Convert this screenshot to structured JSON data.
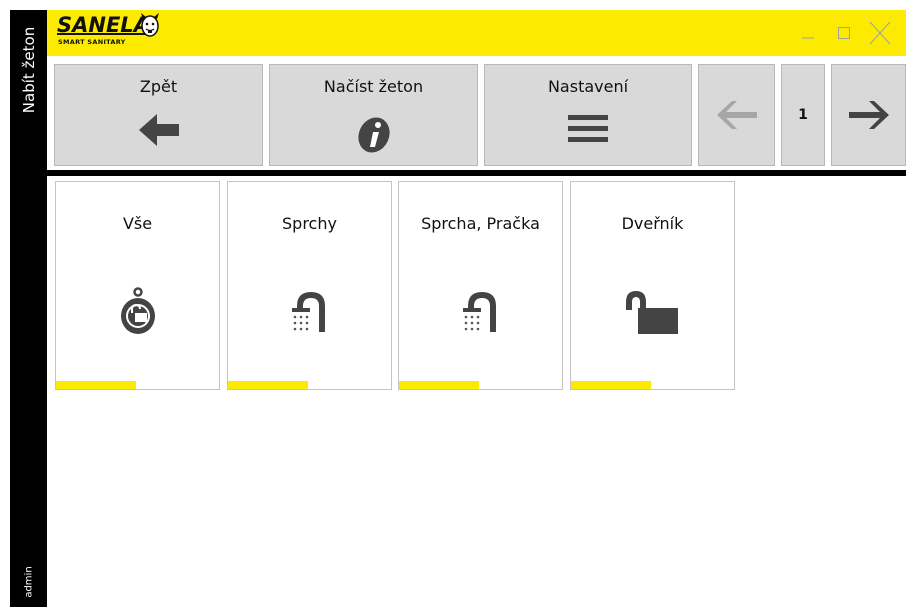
{
  "sidebar": {
    "title": "Nabít žeton",
    "user": "admin"
  },
  "brand": {
    "name": "SANELA",
    "tagline": "SMART SANITARY",
    "registered": "®",
    "icon": "mascot-icon"
  },
  "window_controls": [
    {
      "name": "minimize",
      "icon": "minimize-icon"
    },
    {
      "name": "maximize",
      "icon": "maximize-icon"
    },
    {
      "name": "close",
      "icon": "close-icon"
    }
  ],
  "toolbar": {
    "back": {
      "label": "Zpět",
      "icon": "arrow-left-icon"
    },
    "load_token": {
      "label": "Načíst žeton",
      "icon": "info-icon"
    },
    "settings": {
      "label": "Nastavení",
      "icon": "menu-icon"
    },
    "prev_page": {
      "icon": "arrow-left-icon",
      "enabled": false
    },
    "page": "1",
    "next_page": {
      "icon": "arrow-right-icon",
      "enabled": true
    }
  },
  "tiles": [
    {
      "label": "Vše",
      "icon": "key-fob-icon"
    },
    {
      "label": "Sprchy",
      "icon": "shower-icon"
    },
    {
      "label": "Sprcha, Pračka",
      "icon": "shower-icon"
    },
    {
      "label": "Dveřník",
      "icon": "unlock-icon"
    }
  ],
  "colors": {
    "accent": "#fcea00",
    "sidebar": "#000000",
    "button": "#d9d9d9",
    "icon_dark": "#444444",
    "icon_disabled": "#a6a6a6"
  }
}
